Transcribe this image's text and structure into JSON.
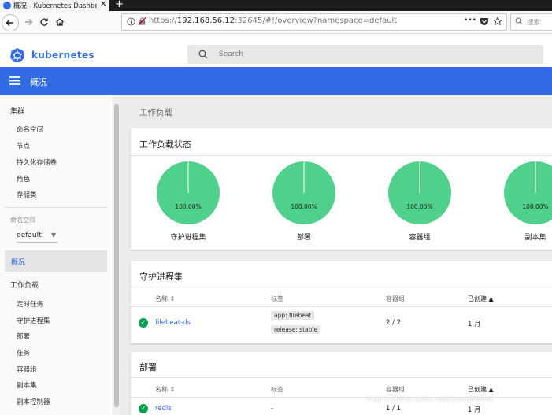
{
  "browser": {
    "tab_title": "概况 - Kubernetes Dashboard",
    "tab_close": "✕",
    "new_tab": "+",
    "url_prefix": "https://",
    "url_host": "192.168.56.12",
    "url_rest": ":32645/#!/overview?namespace=default",
    "search_placeholder": "搜索",
    "more_actions": "•••"
  },
  "header": {
    "brand": "kubernetes",
    "search_placeholder": "Search"
  },
  "titlebar": {
    "title": "概况"
  },
  "sidebar": {
    "cluster_heading": "集群",
    "cluster_items": [
      "命名空间",
      "节点",
      "持久化存储卷",
      "角色",
      "存储类"
    ],
    "namespace_label": "命名空间",
    "namespace_value": "default",
    "overview": "概况",
    "workloads_heading": "工作负载",
    "workload_items": [
      "定时任务",
      "守护进程集",
      "部署",
      "任务",
      "容器组",
      "副本集",
      "副本控制器"
    ]
  },
  "main": {
    "section_title": "工作负载",
    "status_card": {
      "title": "工作负载状态",
      "charts": [
        {
          "label": "100.00%",
          "name": "守护进程集",
          "value": 100
        },
        {
          "label": "100.00%",
          "name": "部署",
          "value": 100
        },
        {
          "label": "100.00%",
          "name": "容器组",
          "value": 100
        },
        {
          "label": "100.00%",
          "name": "副本集",
          "value": 100
        }
      ],
      "color": "#4fd18b"
    },
    "daemonsets_card": {
      "title": "守护进程集",
      "columns": {
        "name": "名称",
        "labels": "标签",
        "pods": "容器组",
        "created": "已创建"
      },
      "rows": [
        {
          "name": "filebeat-ds",
          "labels": [
            "app: filebeat",
            "release: stable"
          ],
          "pods": "2 / 2",
          "created": "1 月"
        }
      ]
    },
    "deployments_card": {
      "title": "部署",
      "columns": {
        "name": "名称",
        "labels": "标签",
        "pods": "容器组",
        "created": "已创建"
      },
      "rows": [
        {
          "name": "redis",
          "labels": "-",
          "pods": "1 / 1",
          "created": "1 月"
        }
      ]
    }
  },
  "watermark": "https://blog.csdn.net/yangbosos",
  "colors": {
    "accent": "#326ce5",
    "ok": "#00a152"
  }
}
